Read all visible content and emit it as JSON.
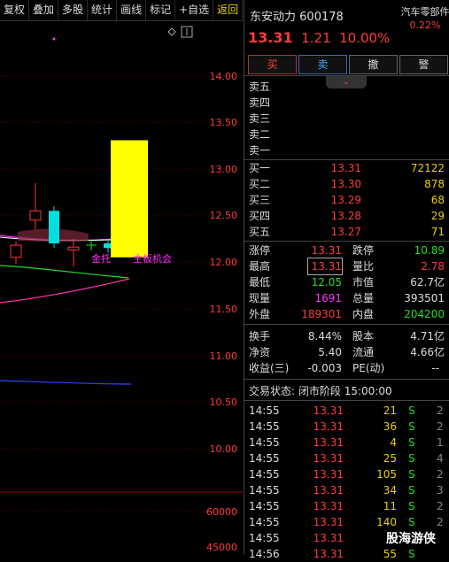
{
  "toolbar": {
    "items": [
      "复权",
      "叠加",
      "多股",
      "统计",
      "画线",
      "标记",
      "+自选",
      "返回"
    ]
  },
  "chart": {
    "price_ticks": [
      "14.00",
      "13.50",
      "13.00",
      "12.50",
      "12.00",
      "11.50",
      "11.00",
      "10.50",
      "10.00"
    ],
    "volume_ticks": [
      "60000",
      "45000"
    ],
    "annotations": [
      "金托",
      "主板机会"
    ],
    "colors": {
      "up": "#ff3333",
      "down": "#00e0e0",
      "highlight": "#ffff00",
      "grid": "#5a0000"
    }
  },
  "chart_data": {
    "type": "candlestick",
    "ylim": [
      9.8,
      14.2
    ],
    "candles": [
      {
        "open": 12.05,
        "close": 12.18,
        "high": 12.22,
        "low": 11.98,
        "dir": "up"
      },
      {
        "open": 12.45,
        "close": 12.55,
        "high": 12.85,
        "low": 12.35,
        "dir": "up"
      },
      {
        "open": 12.55,
        "close": 12.2,
        "high": 12.6,
        "low": 12.15,
        "dir": "down"
      },
      {
        "open": 12.13,
        "close": 12.16,
        "high": 12.25,
        "low": 11.95,
        "dir": "up"
      },
      {
        "open": 12.2,
        "close": 12.15,
        "high": 12.25,
        "low": 12.1,
        "dir": "down"
      },
      {
        "open": 12.05,
        "close": 13.31,
        "high": 13.31,
        "low": 12.05,
        "dir": "highlight"
      }
    ]
  },
  "quote": {
    "name": "东安动力",
    "code": "600178",
    "price": "13.31",
    "change": "1.21",
    "pct": "10.00%",
    "sector_name": "汽车零部件",
    "sector_pct": "0.22%"
  },
  "buttons": {
    "buy": "买",
    "sell": "卖",
    "cancel": "撤",
    "alert": "警"
  },
  "asks": [
    {
      "label": "卖五",
      "price": "",
      "vol": ""
    },
    {
      "label": "卖四",
      "price": "",
      "vol": ""
    },
    {
      "label": "卖三",
      "price": "",
      "vol": ""
    },
    {
      "label": "卖二",
      "price": "",
      "vol": ""
    },
    {
      "label": "卖一",
      "price": "",
      "vol": ""
    }
  ],
  "bids": [
    {
      "label": "买一",
      "price": "13.31",
      "vol": "72122"
    },
    {
      "label": "买二",
      "price": "13.30",
      "vol": "878"
    },
    {
      "label": "买三",
      "price": "13.29",
      "vol": "68"
    },
    {
      "label": "买四",
      "price": "13.28",
      "vol": "29"
    },
    {
      "label": "买五",
      "price": "13.27",
      "vol": "71"
    }
  ],
  "stats": {
    "limit_up_label": "涨停",
    "limit_up": "13.31",
    "limit_down_label": "跌停",
    "limit_down": "10.89",
    "high_label": "最高",
    "high": "13.31",
    "ratio_label": "量比",
    "ratio": "2.78",
    "low_label": "最低",
    "low": "12.05",
    "mktcap_label": "市值",
    "mktcap": "62.7亿",
    "cur_label": "现量",
    "cur": "1691",
    "total_label": "总量",
    "total": "393501",
    "outer_label": "外盘",
    "outer": "189301",
    "inner_label": "内盘",
    "inner": "204200",
    "turnover_label": "换手",
    "turnover": "8.44%",
    "equity_label": "股本",
    "equity": "4.71亿",
    "nav_label": "净资",
    "nav": "5.40",
    "float_label": "流通",
    "float": "4.66亿",
    "eps_label": "收益(三)",
    "eps": "-0.003",
    "pe_label": "PE(动)",
    "pe": "--"
  },
  "trade_status": {
    "label": "交易状态:",
    "value": "闭市阶段 15:00:00"
  },
  "ticks": [
    {
      "time": "14:55",
      "price": "13.31",
      "vol": "21",
      "side": "S",
      "n": "2"
    },
    {
      "time": "14:55",
      "price": "13.31",
      "vol": "36",
      "side": "S",
      "n": "2"
    },
    {
      "time": "14:55",
      "price": "13.31",
      "vol": "4",
      "side": "S",
      "n": "1"
    },
    {
      "time": "14:55",
      "price": "13.31",
      "vol": "25",
      "side": "S",
      "n": "4"
    },
    {
      "time": "14:55",
      "price": "13.31",
      "vol": "105",
      "side": "S",
      "n": "2"
    },
    {
      "time": "14:55",
      "price": "13.31",
      "vol": "34",
      "side": "S",
      "n": "3"
    },
    {
      "time": "14:55",
      "price": "13.31",
      "vol": "11",
      "side": "S",
      "n": "2"
    },
    {
      "time": "14:55",
      "price": "13.31",
      "vol": "140",
      "side": "S",
      "n": "2"
    },
    {
      "time": "14:55",
      "price": "13.31",
      "vol": "",
      "side": "",
      "n": ""
    },
    {
      "time": "14:56",
      "price": "13.31",
      "vol": "55",
      "side": "S",
      "n": ""
    }
  ],
  "watermark": "股海游侠"
}
